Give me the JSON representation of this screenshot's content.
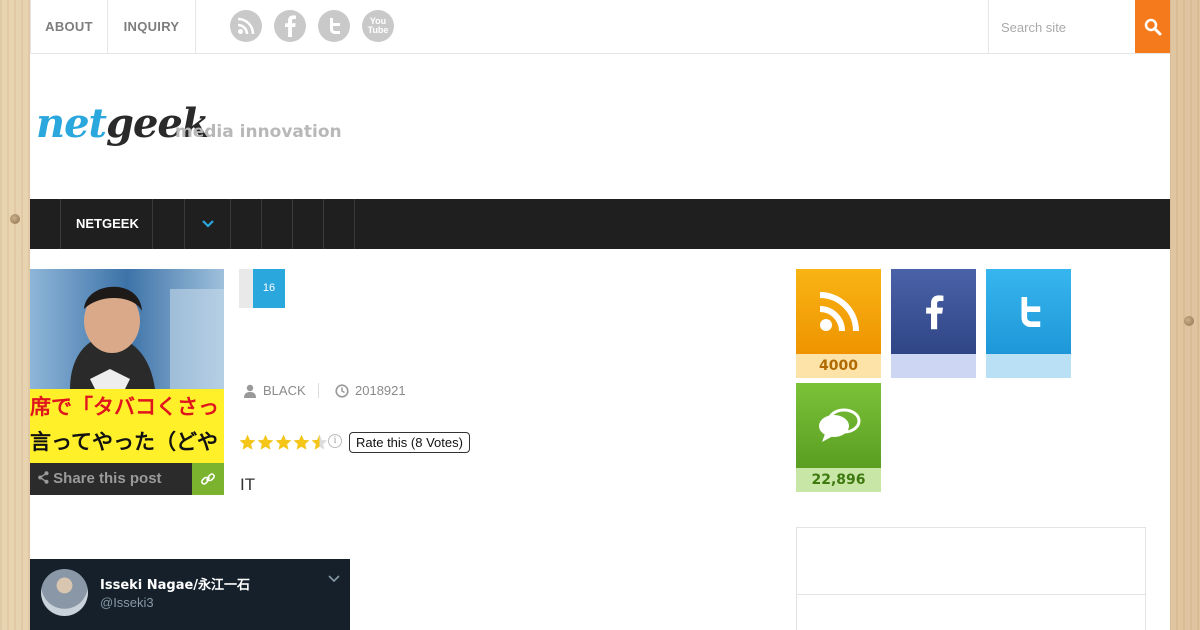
{
  "topbar": {
    "links": [
      {
        "label": "ABOUT"
      },
      {
        "label": "INQUIRY"
      }
    ],
    "social": [
      "rss-icon",
      "facebook-icon",
      "twitter-icon",
      "youtube-icon"
    ],
    "youtube_text": "You Tube",
    "search_placeholder": "Search site"
  },
  "logo": {
    "net": "net",
    "geek": "geek",
    "tagline": "media innovation"
  },
  "nav": {
    "items": [
      {
        "label": "NETGEEK"
      }
    ]
  },
  "post": {
    "thumbnail_caption_line1": "席で「タバコくさっ",
    "thumbnail_caption_line2": "言ってやった（どや",
    "share_label": "Share this post",
    "date_day": "16",
    "author": "BLACK",
    "date": "2018921",
    "rating_value": 4.5,
    "rating_max": 5,
    "rating_label": "Rate this (8 Votes)",
    "excerpt": "IT"
  },
  "tweet": {
    "name": "Isseki Nagae/永江一石",
    "handle": "@Isseki3"
  },
  "sidebar": {
    "counters": [
      {
        "name": "rss",
        "count": "4000",
        "color": "#f5a300",
        "count_bg": "#fde3a8",
        "count_color": "#b06a00"
      },
      {
        "name": "facebook",
        "count": "",
        "color": "#3b5198",
        "count_bg": "#cdd6f2",
        "count_color": "#3b5198"
      },
      {
        "name": "twitter",
        "count": "",
        "color": "#2daae6",
        "count_bg": "#b9e0f5",
        "count_color": "#1b7fb0"
      },
      {
        "name": "comments",
        "count": "22,896",
        "color": "#6fb32f",
        "count_bg": "#c8e6a5",
        "count_color": "#3e7a10"
      }
    ]
  },
  "colors": {
    "accent_blue": "#2aa7dc",
    "search_orange": "#f57a1b",
    "nav_bg": "#1f1f1f",
    "share_green": "#7bb32e"
  }
}
